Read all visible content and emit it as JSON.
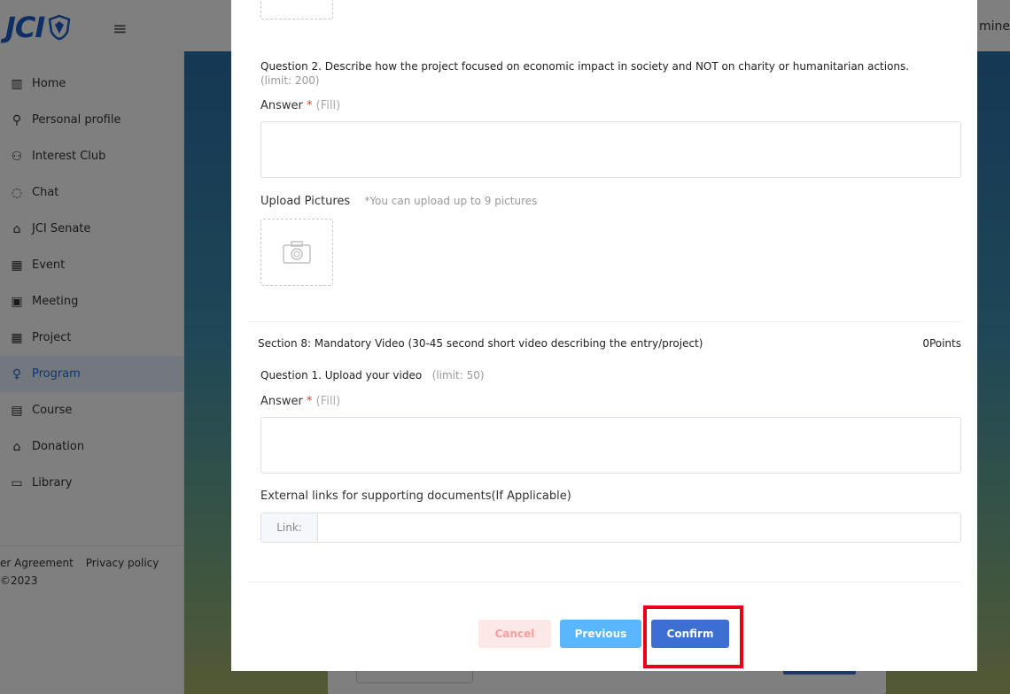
{
  "app": {
    "logo_text": "JCI",
    "header_user": "mine",
    "colors": {
      "brand": "#1a5fc7",
      "active": "#1e6fd9",
      "confirm": "#3c6fd1",
      "previous": "#59b6ff",
      "highlight": "#e8001a"
    }
  },
  "sidebar": {
    "items": [
      {
        "label": "Home",
        "icon": "home-icon",
        "glyph": "▥",
        "active": false
      },
      {
        "label": "Personal profile",
        "icon": "person-icon",
        "glyph": "⚲",
        "active": false
      },
      {
        "label": "Interest Club",
        "icon": "group-icon",
        "glyph": "⚇",
        "active": false
      },
      {
        "label": "Chat",
        "icon": "chat-icon",
        "glyph": "◌",
        "active": false
      },
      {
        "label": "JCI Senate",
        "icon": "senate-icon",
        "glyph": "⌂",
        "active": false
      },
      {
        "label": "Event",
        "icon": "calendar-icon",
        "glyph": "▦",
        "active": false
      },
      {
        "label": "Meeting",
        "icon": "presentation-icon",
        "glyph": "▣",
        "active": false
      },
      {
        "label": "Project",
        "icon": "grid-icon",
        "glyph": "▦",
        "active": false
      },
      {
        "label": "Program",
        "icon": "award-icon",
        "glyph": "♀",
        "active": true
      },
      {
        "label": "Course",
        "icon": "course-icon",
        "glyph": "▤",
        "active": false
      },
      {
        "label": "Donation",
        "icon": "bank-icon",
        "glyph": "⌂",
        "active": false
      },
      {
        "label": "Library",
        "icon": "book-icon",
        "glyph": "▭",
        "active": false
      }
    ],
    "footer": {
      "agreement": "er Agreement",
      "privacy": "Privacy policy",
      "copyright": "©2023"
    }
  },
  "modal": {
    "q2": {
      "text": "Question 2.   Describe how the project focused on economic impact in society and NOT on charity or humanitarian actions.",
      "limit": "(limit: 200)",
      "answer_label": "Answer",
      "required_mark": "*",
      "hint": "(Fill)"
    },
    "upload": {
      "label": "Upload Pictures",
      "note": "*You can upload up to 9 pictures"
    },
    "section8": {
      "title": "Section 8:  Mandatory Video (30-45 second short video describing the entry/project)",
      "points": "0Points"
    },
    "q1": {
      "text": "Question 1.   Upload your video",
      "limit": "(limit: 50)",
      "answer_label": "Answer",
      "required_mark": "*",
      "hint": "(Fill)"
    },
    "external_links": {
      "label": "External links for supporting documents(If Applicable)",
      "prefix": "Link:",
      "value": ""
    },
    "buttons": {
      "cancel": "Cancel",
      "previous": "Previous",
      "confirm": "Confirm"
    }
  }
}
